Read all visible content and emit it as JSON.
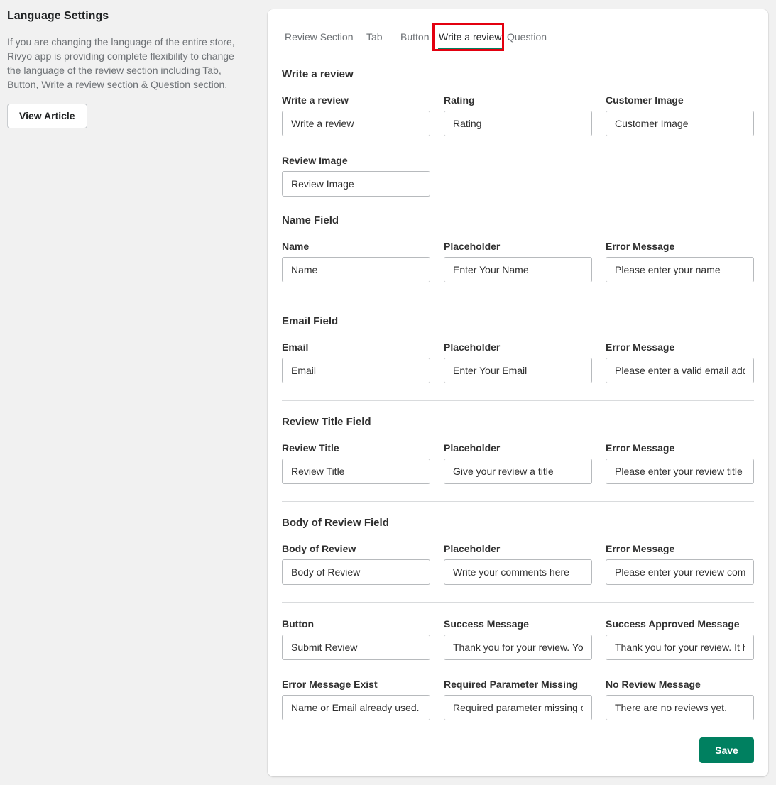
{
  "sidebar": {
    "title": "Language Settings",
    "description": "If you are changing the language of the entire store, Rivyo app is providing complete flexibility to change the language of the review section including Tab, Button, Write a review section & Question section.",
    "view_article_label": "View Article"
  },
  "tabs": [
    {
      "label": "Review Section",
      "active": false
    },
    {
      "label": "Tab",
      "active": false
    },
    {
      "label": "Button",
      "active": false
    },
    {
      "label": "Write a review",
      "active": true
    },
    {
      "label": "Question",
      "active": false
    }
  ],
  "colors": {
    "accent": "#008060",
    "highlight": "#e3000f"
  },
  "sections": [
    {
      "title": "Write a review",
      "fields": [
        {
          "label": "Write a review",
          "value": "Write a review"
        },
        {
          "label": "Rating",
          "value": "Rating"
        },
        {
          "label": "Customer Image",
          "value": "Customer Image"
        },
        {
          "label": "Review Image",
          "value": "Review Image"
        }
      ]
    },
    {
      "title": "Name Field",
      "fields": [
        {
          "label": "Name",
          "value": "Name"
        },
        {
          "label": "Placeholder",
          "value": "Enter Your Name"
        },
        {
          "label": "Error Message",
          "value": "Please enter your name"
        }
      ]
    },
    {
      "title": "Email Field",
      "fields": [
        {
          "label": "Email",
          "value": "Email"
        },
        {
          "label": "Placeholder",
          "value": "Enter Your Email"
        },
        {
          "label": "Error Message",
          "value": "Please enter a valid email address"
        }
      ]
    },
    {
      "title": "Review Title Field",
      "fields": [
        {
          "label": "Review Title",
          "value": "Review Title"
        },
        {
          "label": "Placeholder",
          "value": "Give your review a title"
        },
        {
          "label": "Error Message",
          "value": "Please enter your review title"
        }
      ]
    },
    {
      "title": "Body of Review Field",
      "fields": [
        {
          "label": "Body of Review",
          "value": "Body of Review"
        },
        {
          "label": "Placeholder",
          "value": "Write your comments here"
        },
        {
          "label": "Error Message",
          "value": "Please enter your review comments"
        }
      ]
    },
    {
      "title": "",
      "fields": [
        {
          "label": "Button",
          "value": "Submit Review"
        },
        {
          "label": "Success Message",
          "value": "Thank you for your review. Your review has been submitted."
        },
        {
          "label": "Success Approved Message",
          "value": "Thank you for your review. It has been approved."
        },
        {
          "label": "Error Message Exist",
          "value": "Name or Email already used."
        },
        {
          "label": "Required Parameter Missing",
          "value": "Required parameter missing or invalid."
        },
        {
          "label": "No Review Message",
          "value": "There are no reviews yet."
        }
      ]
    }
  ],
  "save_label": "Save"
}
